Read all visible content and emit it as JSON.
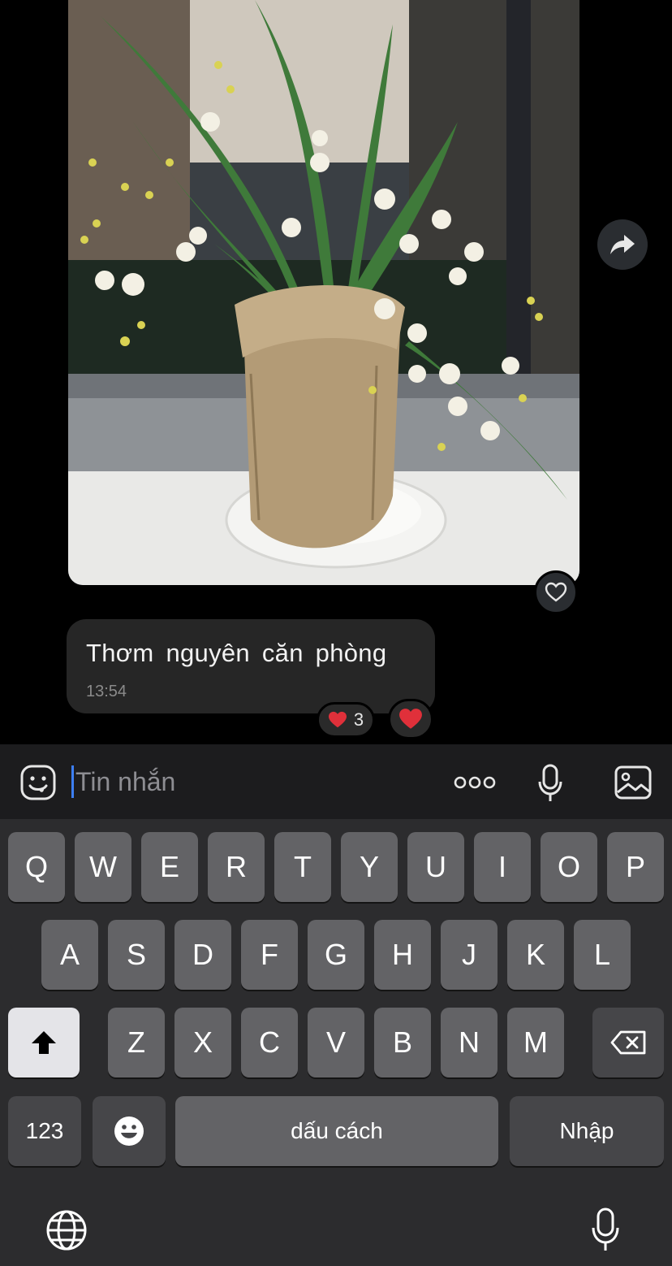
{
  "message": {
    "text": "Thơm nguyên căn phòng",
    "time": "13:54",
    "reactions": {
      "count_label": "3"
    }
  },
  "composer": {
    "placeholder": "Tin nhắn",
    "more_label": "ooo"
  },
  "keyboard": {
    "row1": [
      "Q",
      "W",
      "E",
      "R",
      "T",
      "Y",
      "U",
      "I",
      "O",
      "P"
    ],
    "row2": [
      "A",
      "S",
      "D",
      "F",
      "G",
      "H",
      "J",
      "K",
      "L"
    ],
    "row3": [
      "Z",
      "X",
      "C",
      "V",
      "B",
      "N",
      "M"
    ],
    "numbers_label": "123",
    "space_label": "dấu cách",
    "return_label": "Nhập"
  },
  "icons": {
    "forward": "share-arrow-icon",
    "photo_like": "heart-outline-icon",
    "sticker": "sticker-face-icon",
    "voice": "microphone-icon",
    "gallery": "image-icon",
    "shift": "shift-arrow-icon",
    "delete": "backspace-icon",
    "emoji": "emoji-icon",
    "globe": "globe-icon",
    "dictation": "microphone-icon"
  },
  "colors": {
    "background": "#000000",
    "bubble": "#262626",
    "composer": "#1c1c1e",
    "keyboard": "#2c2c2e",
    "key": "#636366",
    "key_dark": "#464649",
    "caret": "#3d7ff5",
    "heart": "#e0303a"
  }
}
